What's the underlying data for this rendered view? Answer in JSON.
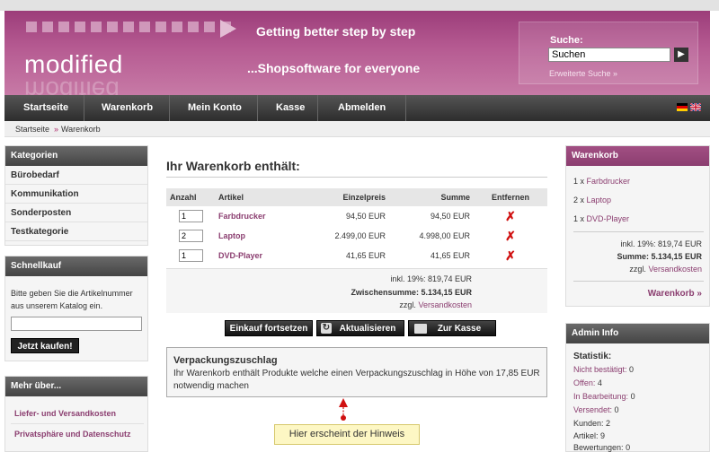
{
  "header": {
    "tagline_top": "Getting better step by step",
    "tagline_bottom": "...Shopsoftware for everyone",
    "logo": "modified",
    "search_label": "Suche:",
    "search_value": "Suchen",
    "advanced_search": "Erweiterte Suche »"
  },
  "nav": {
    "items": [
      {
        "label": "Startseite"
      },
      {
        "label": "Warenkorb"
      },
      {
        "label": "Mein Konto"
      },
      {
        "label": "Kasse"
      },
      {
        "label": "Abmelden"
      }
    ]
  },
  "breadcrumb": {
    "home": "Startseite",
    "sep": "»",
    "current": "Warenkorb"
  },
  "left": {
    "categories": {
      "title": "Kategorien",
      "items": [
        "Bürobedarf",
        "Kommunikation",
        "Sonderposten",
        "Testkategorie"
      ]
    },
    "quickbuy": {
      "title": "Schnellkauf",
      "text": "Bitte geben Sie die Artikelnummer aus unserem Katalog ein.",
      "button": "Jetzt kaufen!"
    },
    "more": {
      "title": "Mehr über...",
      "items": [
        "Liefer- und Versandkosten",
        "Privatsphäre und Datenschutz"
      ]
    }
  },
  "main": {
    "title": "Ihr Warenkorb enthält:",
    "columns": [
      "Anzahl",
      "Artikel",
      "Einzelpreis",
      "Summe",
      "Entfernen"
    ],
    "rows": [
      {
        "qty": "1",
        "name": "Farbdrucker",
        "unit": "94,50 EUR",
        "sum": "94,50 EUR"
      },
      {
        "qty": "2",
        "name": "Laptop",
        "unit": "2.499,00 EUR",
        "sum": "4.998,00 EUR"
      },
      {
        "qty": "1",
        "name": "DVD-Player",
        "unit": "41,65 EUR",
        "sum": "41,65 EUR"
      }
    ],
    "tax": "inkl. 19%: 819,74 EUR",
    "subtotal": "Zwischensumme: 5.134,15 EUR",
    "shipping_prefix": "zzgl.",
    "shipping_link": "Versandkosten",
    "buttons": {
      "continue": "Einkauf fortsetzen",
      "update": "Aktualisieren",
      "checkout": "Zur Kasse"
    },
    "hint": {
      "title": "Verpackungszuschlag",
      "body": "Ihr Warenkorb enthält Produkte welche einen Verpackungszuschlag in Höhe von 17,85 EUR notwendig machen"
    },
    "tooltip": "Hier erscheint der Hinweis"
  },
  "right": {
    "cart": {
      "title": "Warenkorb",
      "items": [
        {
          "qty": "1 x",
          "name": "Farbdrucker"
        },
        {
          "qty": "2 x",
          "name": "Laptop"
        },
        {
          "qty": "1 x",
          "name": "DVD-Player"
        }
      ],
      "tax": "inkl. 19%: 819,74 EUR",
      "sum": "Summe: 5.134,15 EUR",
      "shipping_prefix": "zzgl.",
      "shipping_link": "Versandkosten",
      "link": "Warenkorb »"
    },
    "admin": {
      "title": "Admin Info",
      "heading": "Statistik:",
      "stats": [
        {
          "label": "Nicht bestätigt:",
          "value": "0"
        },
        {
          "label": "Offen:",
          "value": "4"
        },
        {
          "label": "In Bearbeitung:",
          "value": "0"
        },
        {
          "label": "Versendet:",
          "value": "0"
        },
        {
          "label": "Kunden:",
          "value": "2"
        },
        {
          "label": "Artikel:",
          "value": "9"
        },
        {
          "label": "Bewertungen:",
          "value": "0"
        }
      ]
    }
  },
  "colors": {
    "brand": "#8b3e70",
    "nav": "#333333",
    "accent_red": "#d01010"
  }
}
